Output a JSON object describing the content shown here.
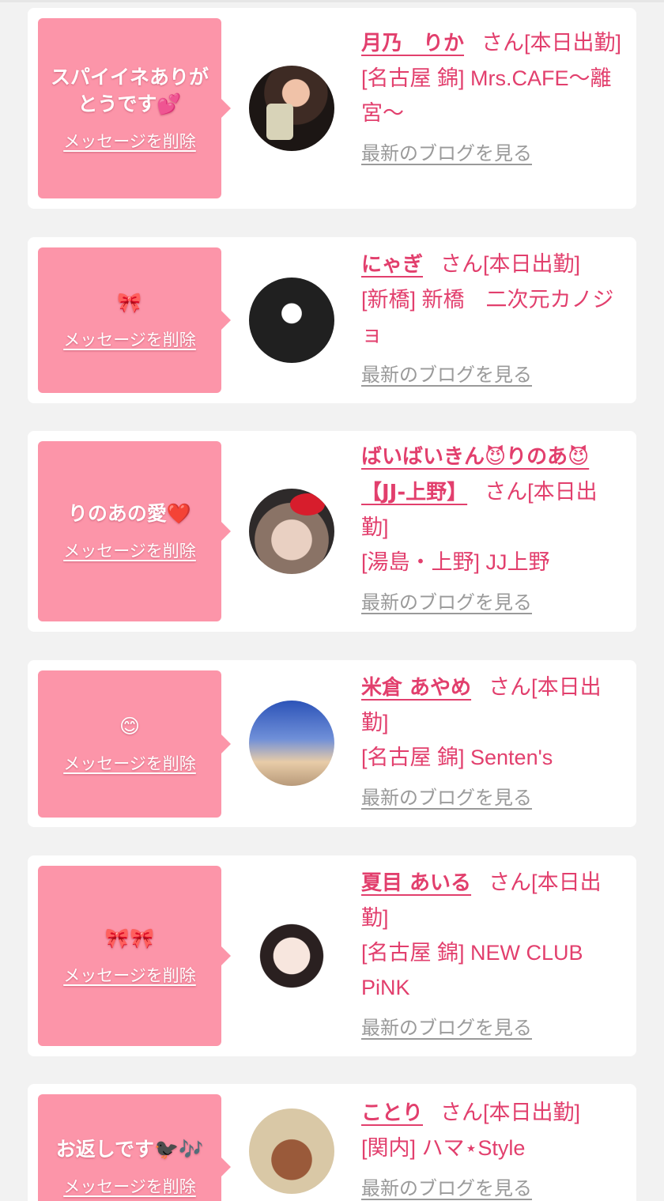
{
  "delete_label": "メッセージを削除",
  "blog_label": "最新のブログを見る",
  "suffix": "さん[本日出勤]",
  "colors": {
    "accent": "#e23f6d",
    "bubble": "#fc95a9",
    "muted": "#9a9a9a",
    "background": "#f2f2f2"
  },
  "cards": [
    {
      "message": "スパイイネありがとうです💕",
      "name": "月乃　りか",
      "shop": "[名古屋 錦] Mrs.CAFE〜離宮〜"
    },
    {
      "message": "🎀",
      "name": "にゃぎ",
      "shop": "[新橋] 新橋　二次元カノジョ"
    },
    {
      "message": "りのあの愛❤️",
      "name": "ばいばいきん😈りのあ😈【JJ-上野】",
      "shop": "[湯島・上野] JJ上野"
    },
    {
      "message": "😊",
      "name": "米倉 あやめ",
      "shop": "[名古屋 錦] Senten's"
    },
    {
      "message": "🎀🎀",
      "name": "夏目 あいる",
      "shop": "[名古屋 錦] NEW CLUB PiNK"
    },
    {
      "message": "お返しです🐦‍⬛🎶",
      "name": "ことり",
      "shop": "[関内] ハマ⋆Style"
    }
  ]
}
